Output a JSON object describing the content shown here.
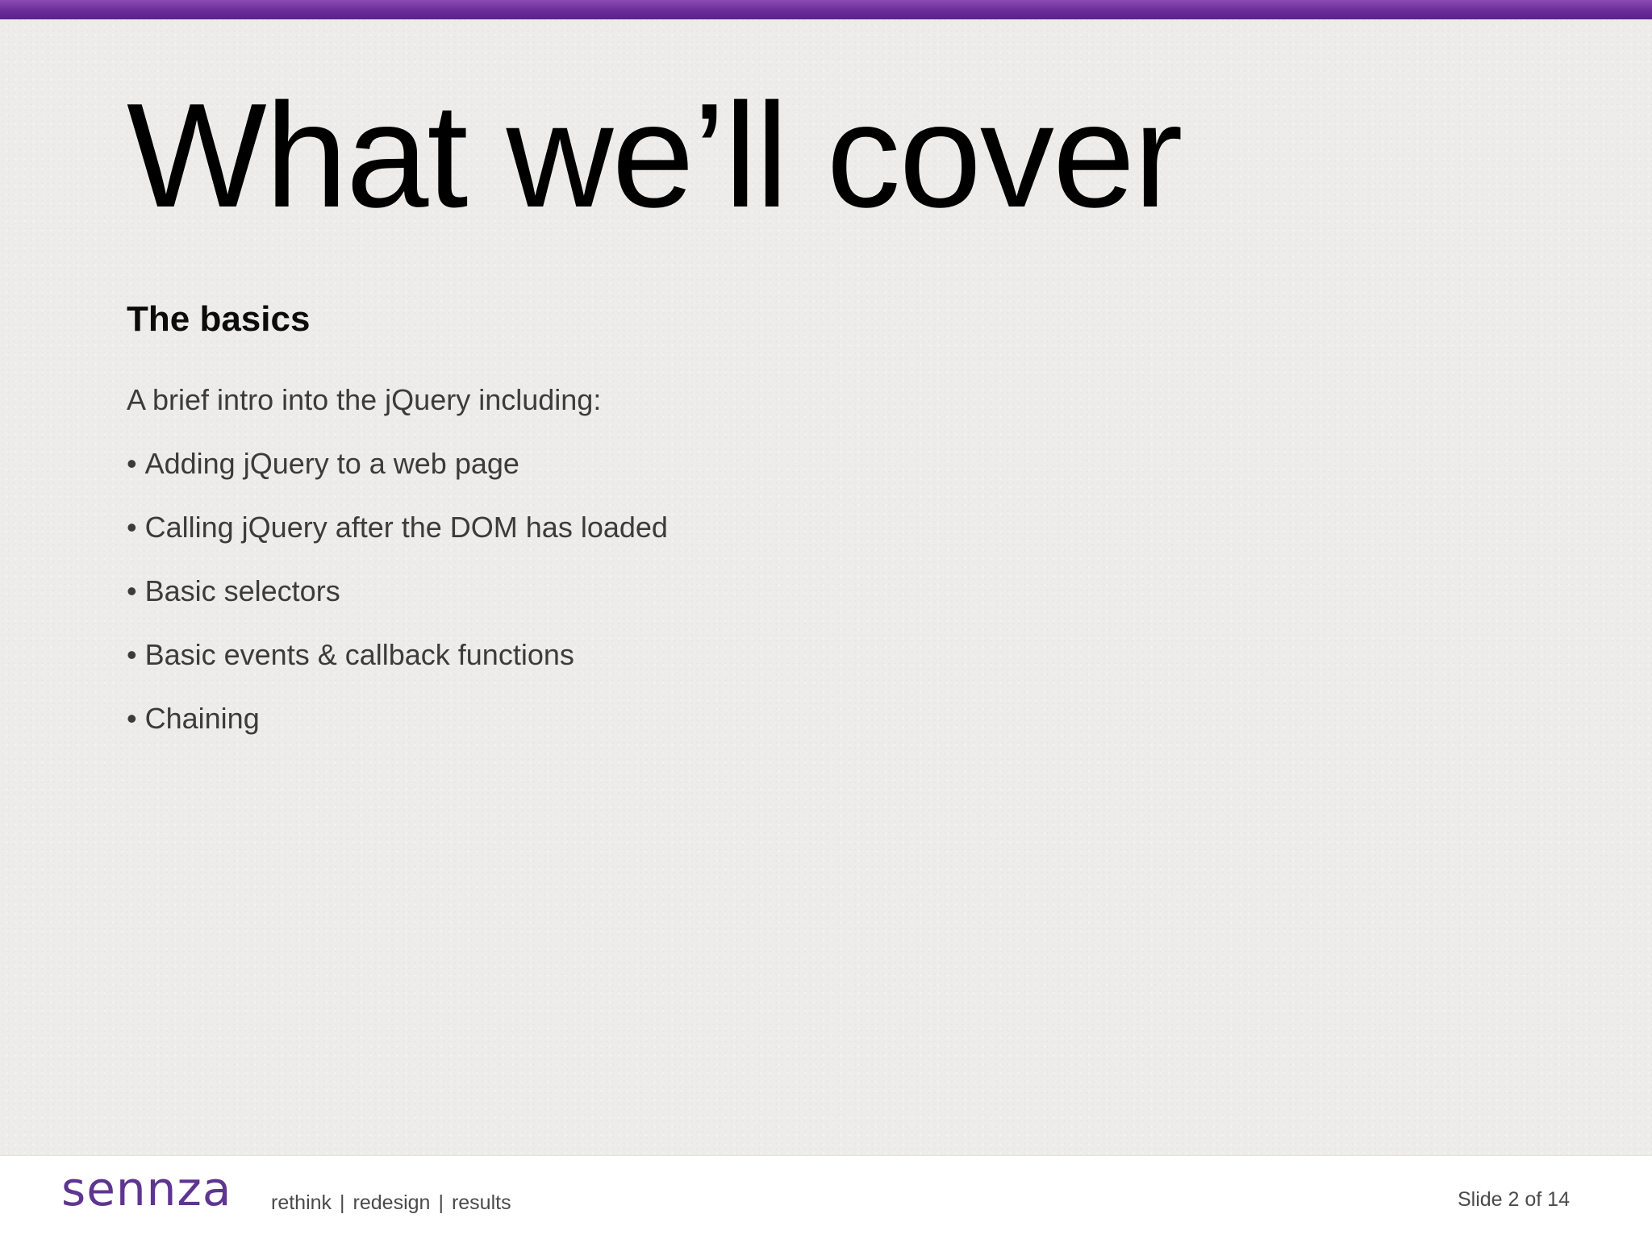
{
  "slide": {
    "title": "What we’ll cover",
    "subtitle": "The basics",
    "intro": "A brief intro into the jQuery including:",
    "bullet_symbol": "•",
    "bullets": [
      "Adding jQuery to a web page",
      "Calling jQuery after the DOM has loaded",
      "Basic selectors",
      "Basic events & callback functions",
      "Chaining"
    ]
  },
  "footer": {
    "logo": "sennza",
    "tagline": [
      "rethink",
      "redesign",
      "results"
    ],
    "separator": "|",
    "slide_number": "Slide 2 of 14"
  },
  "colors": {
    "accent_bar": "#6a2d98",
    "logo": "#5e3590",
    "background": "#edecea",
    "footer_background": "#ffffff"
  }
}
